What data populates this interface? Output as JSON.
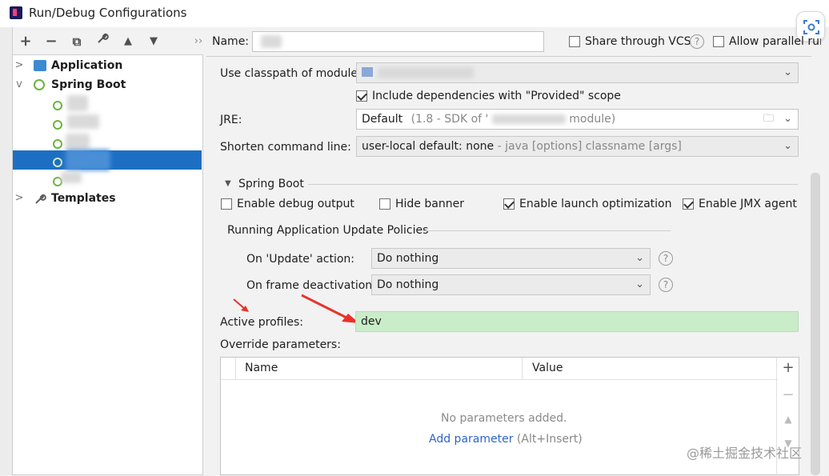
{
  "window": {
    "title": "Run/Debug Configurations"
  },
  "toolbar": {
    "add": "+",
    "remove": "−",
    "copy": "⧉",
    "edit": "🔧",
    "up": "▲",
    "down": "▼",
    "more": "››"
  },
  "tree": {
    "application": "Application",
    "spring_boot": "Spring Boot",
    "templates": "Templates"
  },
  "form": {
    "name_label": "Name:",
    "share_vcs": "Share through VCS",
    "allow_parallel": "Allow parallel run",
    "classpath_label": "Use classpath of module:",
    "include_deps": "Include dependencies with \"Provided\" scope",
    "jre_label": "JRE:",
    "jre_value": "Default",
    "jre_hint_prefix": "(1.8 - SDK of '",
    "jre_hint_suffix": "module)",
    "shorten_label": "Shorten command line:",
    "shorten_value": "user-local default: none",
    "shorten_hint": " - java [options] classname [args]"
  },
  "spring_boot_section": {
    "title": "Spring Boot",
    "debug_output": "Enable debug output",
    "hide_banner": "Hide banner",
    "launch_opt": "Enable launch optimization",
    "jmx_agent": "Enable JMX agent",
    "update_policies": "Running Application Update Policies",
    "update_action_label": "On 'Update' action:",
    "update_action_value": "Do nothing",
    "frame_deact_label": "On frame deactivation:",
    "frame_deact_value": "Do nothing",
    "active_profiles_label": "Active profiles:",
    "active_profiles_value": "dev",
    "override_label": "Override parameters:"
  },
  "params_table": {
    "col_name": "Name",
    "col_value": "Value",
    "empty": "No parameters added.",
    "add_link": "Add parameter",
    "add_shortcut": " (Alt+Insert)"
  },
  "watermark": "@稀土掘金技术社区",
  "colors": {
    "selection": "#1d6fc4",
    "profiles_bg": "#c9ecc9",
    "link": "#2f65ca",
    "arrow": "#e8322a"
  }
}
